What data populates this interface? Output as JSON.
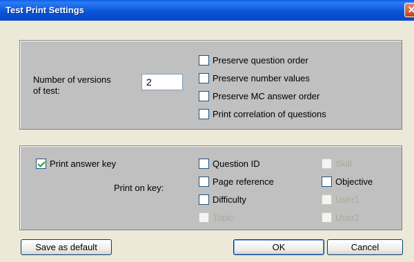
{
  "window": {
    "title": "Test Print Settings",
    "close_glyph": "✕"
  },
  "versions": {
    "label_line1": "Number of versions",
    "label_line2": "of test:",
    "value": "2"
  },
  "options": [
    {
      "label": "Preserve question order",
      "checked": false
    },
    {
      "label": "Preserve number values",
      "checked": false
    },
    {
      "label": "Preserve MC answer order",
      "checked": false
    },
    {
      "label": "Print correlation of questions",
      "checked": false
    }
  ],
  "answer_key": {
    "label": "Print answer key",
    "checked": true,
    "print_on_key_label": "Print on key:",
    "items": [
      {
        "label": "Question ID",
        "checked": false,
        "enabled": true
      },
      {
        "label": "Skill",
        "checked": false,
        "enabled": false
      },
      {
        "label": "Page reference",
        "checked": false,
        "enabled": true
      },
      {
        "label": "Objective",
        "checked": false,
        "enabled": true
      },
      {
        "label": "Difficulty",
        "checked": false,
        "enabled": true
      },
      {
        "label": "User1",
        "checked": false,
        "enabled": false
      },
      {
        "label": "Topic",
        "checked": false,
        "enabled": false
      },
      {
        "label": "User2",
        "checked": false,
        "enabled": false
      }
    ]
  },
  "buttons": {
    "save_default": "Save as default",
    "ok": "OK",
    "cancel": "Cancel"
  }
}
